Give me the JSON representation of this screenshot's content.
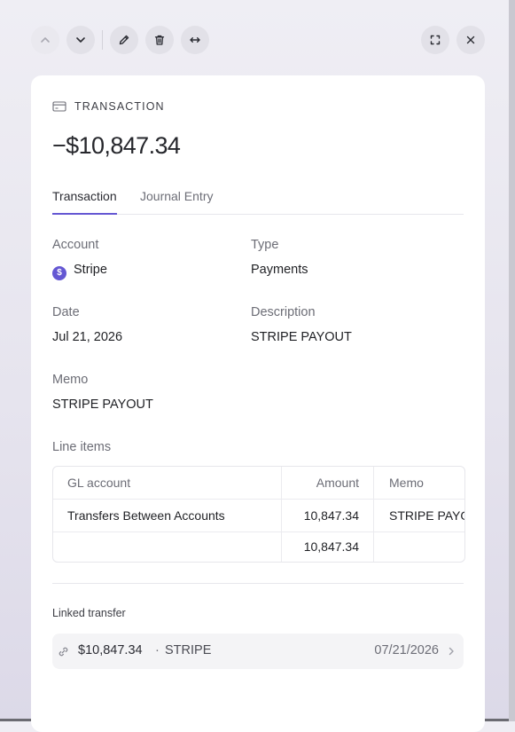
{
  "toolbar": {
    "buttons": [
      {
        "name": "previous",
        "icon": "chevron-up-icon"
      },
      {
        "name": "next",
        "icon": "chevron-down-icon"
      },
      {
        "name": "edit",
        "icon": "pencil-icon"
      },
      {
        "name": "delete",
        "icon": "trash-icon"
      },
      {
        "name": "swap",
        "icon": "arrows-horizontal-icon"
      },
      {
        "name": "expand",
        "icon": "expand-icon"
      },
      {
        "name": "close",
        "icon": "close-icon"
      }
    ]
  },
  "header": {
    "kind_label": "TRANSACTION",
    "kind_icon": "credit-card-icon",
    "amount": "−$10,847.34"
  },
  "tabs": [
    {
      "label": "Transaction",
      "active": true
    },
    {
      "label": "Journal Entry",
      "active": false
    }
  ],
  "details": {
    "account": {
      "label": "Account",
      "value": "Stripe",
      "icon_letter": "$"
    },
    "type": {
      "label": "Type",
      "value": "Payments"
    },
    "date": {
      "label": "Date",
      "value": "Jul 21, 2026"
    },
    "description": {
      "label": "Description",
      "value": "STRIPE PAYOUT"
    },
    "memo": {
      "label": "Memo",
      "value": "STRIPE PAYOUT"
    }
  },
  "line_items": {
    "title": "Line items",
    "columns": [
      "GL account",
      "Amount",
      "Memo"
    ],
    "rows": [
      {
        "gl_account": "Transfers Between Accounts",
        "amount": "10,847.34",
        "memo": "STRIPE PAYOUT"
      }
    ],
    "total": "10,847.34"
  },
  "linked_transfer": {
    "title": "Linked transfer",
    "amount": "$10,847.34",
    "separator": "·",
    "name": "STRIPE",
    "date": "07/21/2026"
  },
  "colors": {
    "accent": "#6558d3",
    "panel": "#ffffff",
    "backdrop": "#e6e4ee"
  }
}
